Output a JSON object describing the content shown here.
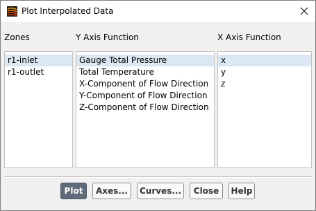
{
  "window": {
    "title": "Plot Interpolated Data",
    "icon": "fluent-app-icon",
    "close_icon": "close-icon"
  },
  "columns": {
    "zones_label": "Zones",
    "y_axis_label": "Y Axis Function",
    "x_axis_label": "X Axis Function"
  },
  "zones": {
    "items": [
      "r1-inlet",
      "r1-outlet"
    ],
    "selected": "r1-inlet"
  },
  "y_axis_functions": {
    "items": [
      "Gauge Total Pressure",
      "Total Temperature",
      "X-Component of Flow Direction",
      "Y-Component of Flow Direction",
      "Z-Component of Flow Direction"
    ],
    "selected": "Gauge Total Pressure"
  },
  "x_axis_functions": {
    "items": [
      "x",
      "y",
      "z"
    ],
    "selected": "x"
  },
  "buttons": {
    "plot": "Plot",
    "axes": "Axes...",
    "curves": "Curves...",
    "close": "Close",
    "help": "Help"
  },
  "colors": {
    "selection": "#dbe7f3",
    "primary_button": "#5f6b78",
    "dialog_background": "#f0f0f0"
  }
}
